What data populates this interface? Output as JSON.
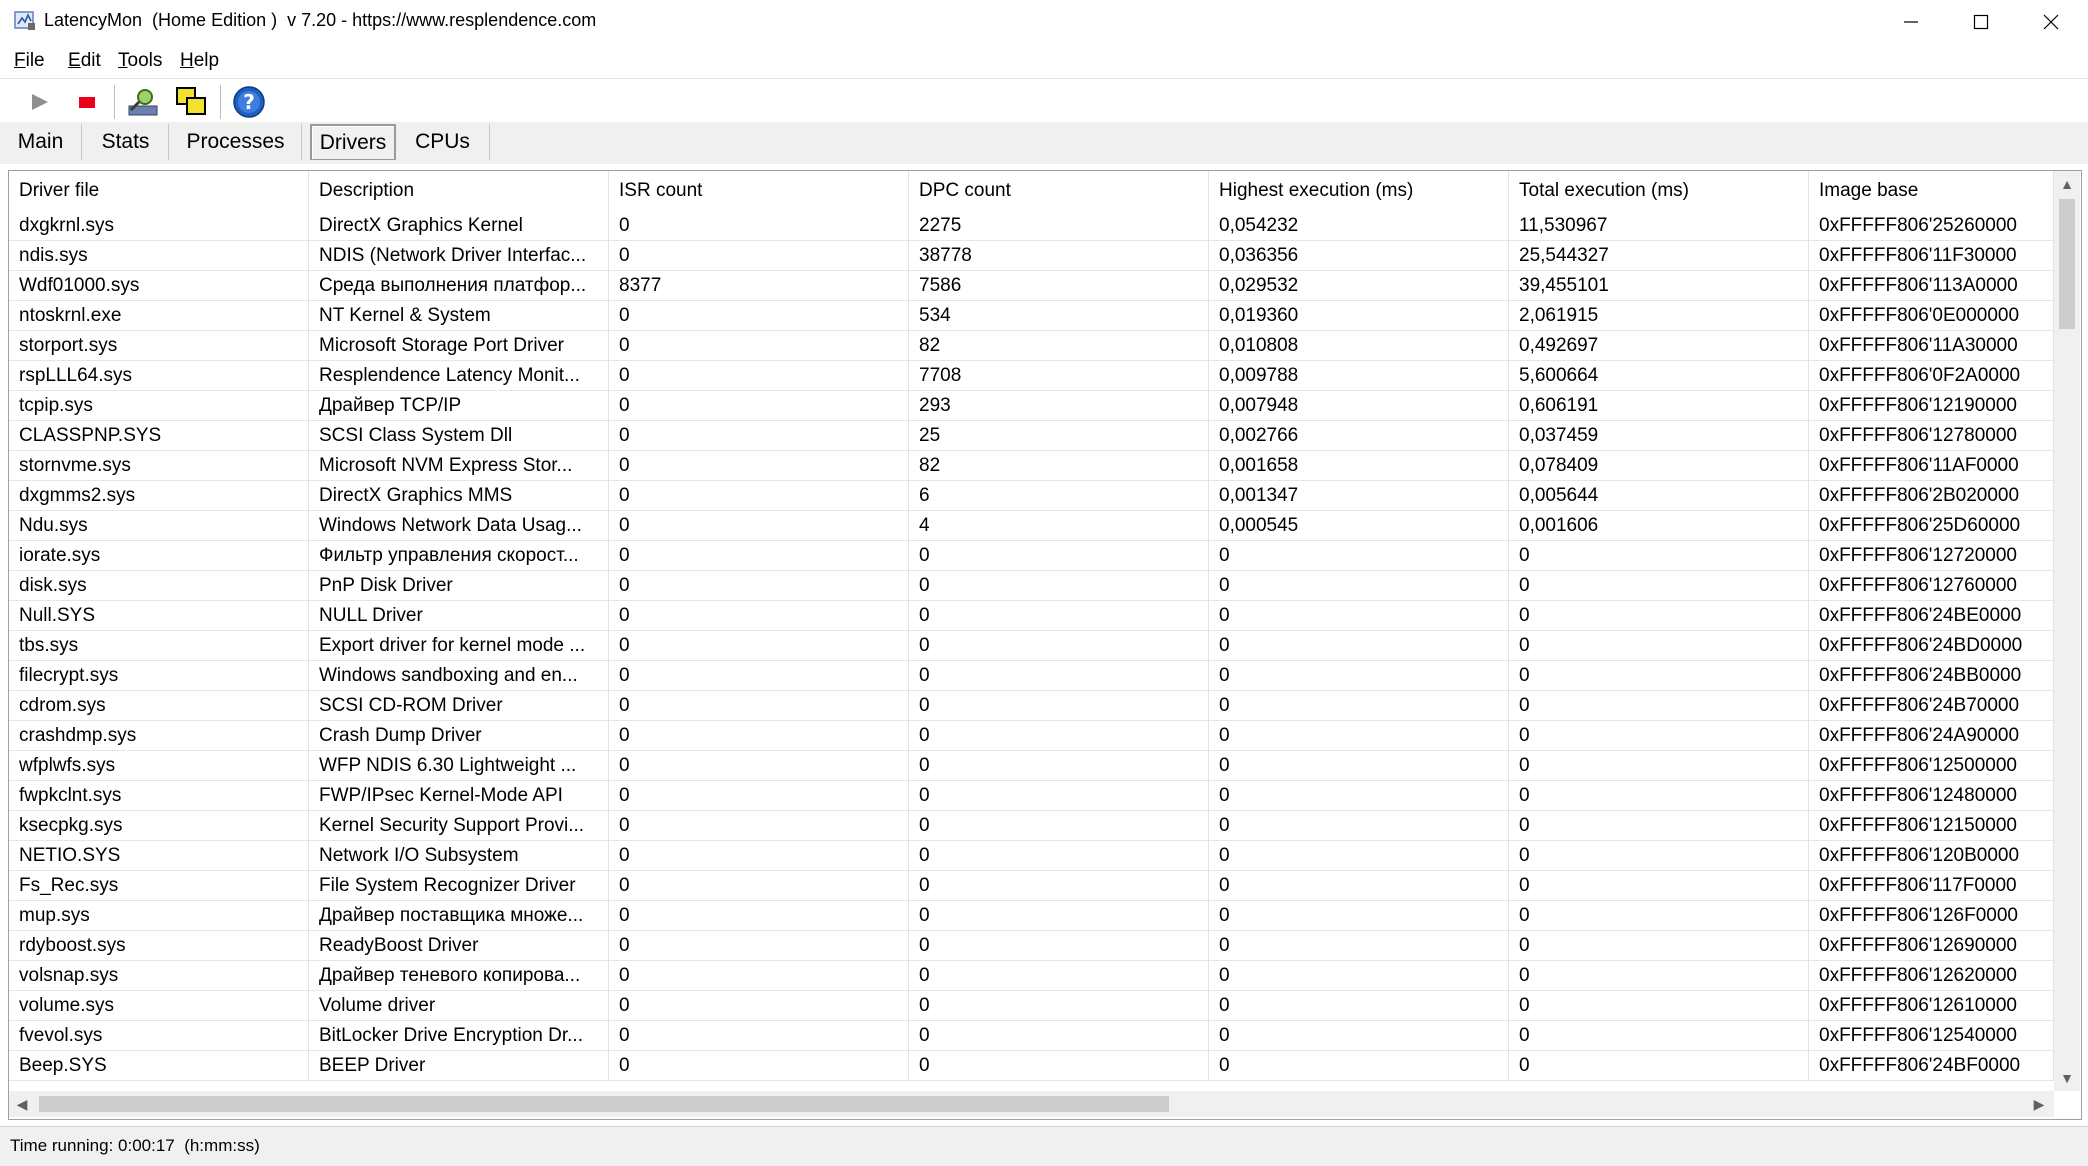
{
  "window": {
    "title": "LatencyMon  (Home Edition )  v 7.20 - https://www.resplendence.com",
    "minimize_glyph": "—",
    "maximize_glyph": "☐",
    "close_glyph": "✕"
  },
  "menu": [
    {
      "acc": "F",
      "rest": "ile"
    },
    {
      "acc": "E",
      "rest": "dit"
    },
    {
      "acc": "T",
      "rest": "ools"
    },
    {
      "acc": "H",
      "rest": "elp"
    }
  ],
  "toolbar": {
    "icons": [
      "play-icon",
      "stop-icon",
      "search-drivers-icon",
      "windows-icon",
      "help-icon"
    ],
    "colors": {
      "play": "#8f8f8f",
      "stop": "#e8001c",
      "help": "#1f5fbf"
    }
  },
  "tabs": [
    {
      "label": "Main",
      "active": false
    },
    {
      "label": "Stats",
      "active": false
    },
    {
      "label": "Processes",
      "active": false
    },
    {
      "label": "Drivers",
      "active": true
    },
    {
      "label": "CPUs",
      "active": false
    }
  ],
  "table": {
    "columns": [
      "Driver file",
      "Description",
      "ISR count",
      "DPC count",
      "Highest execution (ms)",
      "Total execution (ms)",
      "Image base"
    ],
    "rows": [
      [
        "dxgkrnl.sys",
        "DirectX Graphics Kernel",
        "0",
        "2275",
        "0,054232",
        "11,530967",
        "0xFFFFF806'25260000"
      ],
      [
        "ndis.sys",
        "NDIS (Network Driver Interfac...",
        "0",
        "38778",
        "0,036356",
        "25,544327",
        "0xFFFFF806'11F30000"
      ],
      [
        "Wdf01000.sys",
        "Среда выполнения платфор...",
        "8377",
        "7586",
        "0,029532",
        "39,455101",
        "0xFFFFF806'113A0000"
      ],
      [
        "ntoskrnl.exe",
        "NT Kernel & System",
        "0",
        "534",
        "0,019360",
        "2,061915",
        "0xFFFFF806'0E000000"
      ],
      [
        "storport.sys",
        "Microsoft Storage Port Driver",
        "0",
        "82",
        "0,010808",
        "0,492697",
        "0xFFFFF806'11A30000"
      ],
      [
        "rspLLL64.sys",
        "Resplendence Latency Monit...",
        "0",
        "7708",
        "0,009788",
        "5,600664",
        "0xFFFFF806'0F2A0000"
      ],
      [
        "tcpip.sys",
        "Драйвер TCP/IP",
        "0",
        "293",
        "0,007948",
        "0,606191",
        "0xFFFFF806'12190000"
      ],
      [
        "CLASSPNP.SYS",
        "SCSI Class System Dll",
        "0",
        "25",
        "0,002766",
        "0,037459",
        "0xFFFFF806'12780000"
      ],
      [
        "stornvme.sys",
        "Microsoft NVM Express Stor...",
        "0",
        "82",
        "0,001658",
        "0,078409",
        "0xFFFFF806'11AF0000"
      ],
      [
        "dxgmms2.sys",
        "DirectX Graphics MMS",
        "0",
        "6",
        "0,001347",
        "0,005644",
        "0xFFFFF806'2B020000"
      ],
      [
        "Ndu.sys",
        "Windows Network Data Usag...",
        "0",
        "4",
        "0,000545",
        "0,001606",
        "0xFFFFF806'25D60000"
      ],
      [
        "iorate.sys",
        "Фильтр управления скорост...",
        "0",
        "0",
        "0",
        "0",
        "0xFFFFF806'12720000"
      ],
      [
        "disk.sys",
        "PnP Disk Driver",
        "0",
        "0",
        "0",
        "0",
        "0xFFFFF806'12760000"
      ],
      [
        "Null.SYS",
        "NULL Driver",
        "0",
        "0",
        "0",
        "0",
        "0xFFFFF806'24BE0000"
      ],
      [
        "tbs.sys",
        "Export driver for kernel mode ...",
        "0",
        "0",
        "0",
        "0",
        "0xFFFFF806'24BD0000"
      ],
      [
        "filecrypt.sys",
        "Windows sandboxing and en...",
        "0",
        "0",
        "0",
        "0",
        "0xFFFFF806'24BB0000"
      ],
      [
        "cdrom.sys",
        "SCSI CD-ROM Driver",
        "0",
        "0",
        "0",
        "0",
        "0xFFFFF806'24B70000"
      ],
      [
        "crashdmp.sys",
        "Crash Dump Driver",
        "0",
        "0",
        "0",
        "0",
        "0xFFFFF806'24A90000"
      ],
      [
        "wfplwfs.sys",
        "WFP NDIS 6.30 Lightweight ...",
        "0",
        "0",
        "0",
        "0",
        "0xFFFFF806'12500000"
      ],
      [
        "fwpkclnt.sys",
        "FWP/IPsec Kernel-Mode API",
        "0",
        "0",
        "0",
        "0",
        "0xFFFFF806'12480000"
      ],
      [
        "ksecpkg.sys",
        "Kernel Security Support Provi...",
        "0",
        "0",
        "0",
        "0",
        "0xFFFFF806'12150000"
      ],
      [
        "NETIO.SYS",
        "Network I/O Subsystem",
        "0",
        "0",
        "0",
        "0",
        "0xFFFFF806'120B0000"
      ],
      [
        "Fs_Rec.sys",
        "File System Recognizer Driver",
        "0",
        "0",
        "0",
        "0",
        "0xFFFFF806'117F0000"
      ],
      [
        "mup.sys",
        "Драйвер поставщика множе...",
        "0",
        "0",
        "0",
        "0",
        "0xFFFFF806'126F0000"
      ],
      [
        "rdyboost.sys",
        "ReadyBoost Driver",
        "0",
        "0",
        "0",
        "0",
        "0xFFFFF806'12690000"
      ],
      [
        "volsnap.sys",
        "Драйвер теневого копирова...",
        "0",
        "0",
        "0",
        "0",
        "0xFFFFF806'12620000"
      ],
      [
        "volume.sys",
        "Volume driver",
        "0",
        "0",
        "0",
        "0",
        "0xFFFFF806'12610000"
      ],
      [
        "fvevol.sys",
        "BitLocker Drive Encryption Dr...",
        "0",
        "0",
        "0",
        "0",
        "0xFFFFF806'12540000"
      ],
      [
        "Beep.SYS",
        "BEEP Driver",
        "0",
        "0",
        "0",
        "0",
        "0xFFFFF806'24BF0000"
      ]
    ]
  },
  "scrollbar": {
    "up": "▲",
    "down": "▼",
    "left": "◀",
    "right": "▶"
  },
  "status": {
    "text": "Time running: 0:00:17  (h:mm:ss)"
  }
}
